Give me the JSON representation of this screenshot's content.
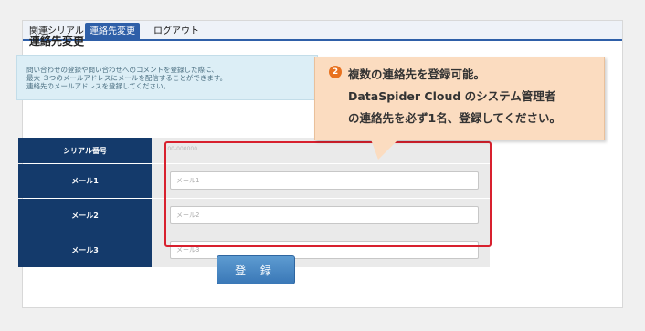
{
  "tabs": [
    "関連シリアル",
    "連絡先変更",
    "ログアウト"
  ],
  "page_title": "連絡先変更",
  "info_lines": [
    "問い合わせの登録や問い合わせへのコメントを登録した際に、",
    "最大 ３つのメールアドレスにメールを配信することができます。",
    "連絡先のメールアドレスを登録してください。"
  ],
  "form": {
    "serial_label": "シリアル番号",
    "serial_value": "L00-000000",
    "mail1_label": "メール1",
    "mail1_placeholder": "メール1",
    "mail2_label": "メール2",
    "mail2_placeholder": "メール2",
    "mail3_label": "メール3",
    "mail3_placeholder": "メール3"
  },
  "submit_label": "登 録",
  "callout": {
    "number": "2",
    "line1": "複数の連絡先を登録可能。",
    "line2": "DataSpider Cloud のシステム管理者",
    "line3": "の連絡先を必ず1名、登録してください。"
  },
  "colors": {
    "header_cell": "#143a6b",
    "tab_active": "#2e5fa8",
    "highlight": "#d8202e",
    "callout_bg": "#fbdcc0",
    "badge": "#e8711e"
  }
}
